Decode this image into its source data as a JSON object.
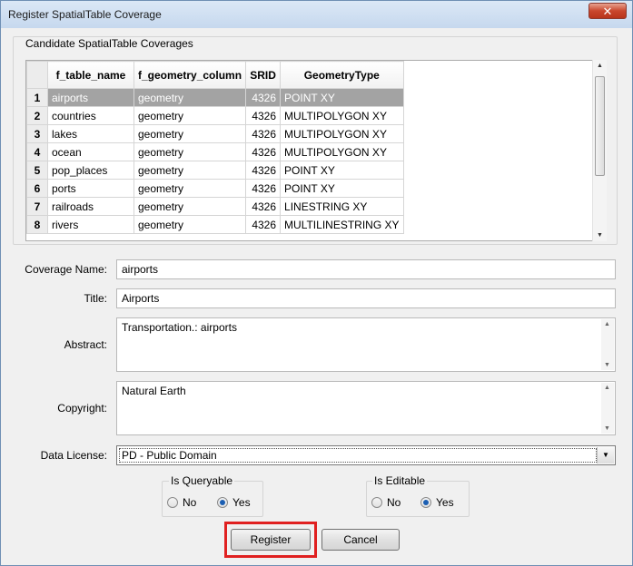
{
  "window": {
    "title": "Register SpatialTable Coverage",
    "close_glyph": "✕"
  },
  "candidates": {
    "group_label": "Candidate SpatialTable Coverages",
    "columns": [
      "f_table_name",
      "f_geometry_column",
      "SRID",
      "GeometryType"
    ],
    "rows": [
      {
        "n": "1",
        "name": "airports",
        "geom": "geometry",
        "srid": "4326",
        "type": "POINT XY"
      },
      {
        "n": "2",
        "name": "countries",
        "geom": "geometry",
        "srid": "4326",
        "type": "MULTIPOLYGON XY"
      },
      {
        "n": "3",
        "name": "lakes",
        "geom": "geometry",
        "srid": "4326",
        "type": "MULTIPOLYGON XY"
      },
      {
        "n": "4",
        "name": "ocean",
        "geom": "geometry",
        "srid": "4326",
        "type": "MULTIPOLYGON XY"
      },
      {
        "n": "5",
        "name": "pop_places",
        "geom": "geometry",
        "srid": "4326",
        "type": "POINT XY"
      },
      {
        "n": "6",
        "name": "ports",
        "geom": "geometry",
        "srid": "4326",
        "type": "POINT XY"
      },
      {
        "n": "7",
        "name": "railroads",
        "geom": "geometry",
        "srid": "4326",
        "type": "LINESTRING XY"
      },
      {
        "n": "8",
        "name": "rivers",
        "geom": "geometry",
        "srid": "4326",
        "type": "MULTILINESTRING XY"
      }
    ]
  },
  "form": {
    "coverage_name_label": "Coverage Name:",
    "coverage_name_value": "airports",
    "title_label": "Title:",
    "title_value": "Airports",
    "abstract_label": "Abstract:",
    "abstract_value": "Transportation.: airports",
    "copyright_label": "Copyright:",
    "copyright_value": "Natural Earth",
    "license_label": "Data License:",
    "license_value": "PD - Public Domain"
  },
  "queryable": {
    "title": "Is Queryable",
    "no": "No",
    "yes": "Yes"
  },
  "editable": {
    "title": "Is Editable",
    "no": "No",
    "yes": "Yes"
  },
  "buttons": {
    "register": "Register",
    "cancel": "Cancel"
  }
}
